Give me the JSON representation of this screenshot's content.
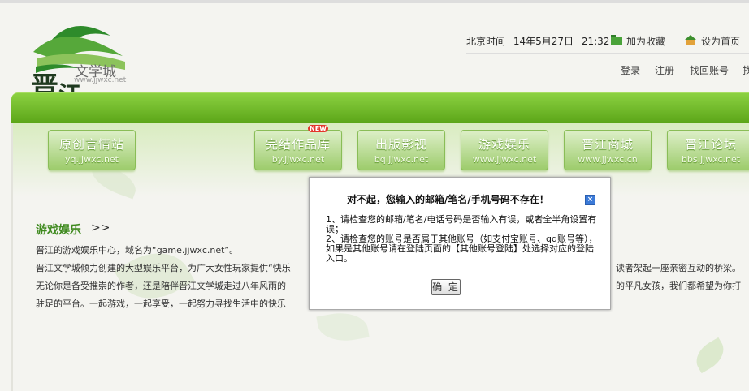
{
  "logo": {
    "text": "文学城",
    "url": "www.jjwxc.net"
  },
  "header": {
    "time_label": "北京时间",
    "date": "14年5月27日",
    "time": "21:32",
    "bookmark": "加为收藏",
    "homepage": "设为首页"
  },
  "nav": {
    "login": "登录",
    "register": "注册",
    "recover": "找回账号",
    "more": "找"
  },
  "sites": [
    {
      "title": "原创言情站",
      "url": "yq.jjwxc.net"
    },
    {
      "title": "完结作品库",
      "url": "by.jjwxc.net",
      "badge": "NEW"
    },
    {
      "title": "出版影视",
      "url": "bq.jjwxc.net"
    },
    {
      "title": "游戏娱乐",
      "url": "www.jjwxc.net"
    },
    {
      "title": "晋江商城",
      "url": "www.jjwxc.cn"
    },
    {
      "title": "晋江论坛",
      "url": "bbs.jjwxc.net"
    }
  ],
  "section": {
    "title": "游戏娱乐",
    "arrow": ">>",
    "lines": [
      "晋江的游戏娱乐中心，域名为“game.jjwxc.net”。",
      "晋江文学城倾力创建的大型娱乐平台，为广大女性玩家提供“快乐",
      "无论你是备受推崇的作者，还是陪伴晋江文学城走过八年风雨的",
      "驻足的平台。一起游戏，一起享受，一起努力寻找生活中的快乐"
    ],
    "line2_tail": "读者架起一座亲密互动的桥梁。",
    "line3_tail": "的平凡女孩，我们都希望为你打"
  },
  "dialog": {
    "title": "对不起，您输入的邮箱/笔名/手机号码不存在！",
    "close": "×",
    "items": [
      "1、请检查您的邮箱/笔名/电话号码是否输入有误，或者全半角设置有误；",
      "2、请检查您的账号是否属于其他账号（如支付宝账号、qq账号等），如果是其他账号请在登陆页面的【其他账号登陆】处选择对应的登陆入口。"
    ],
    "confirm": "确 定"
  },
  "colors": {
    "brand_green": "#5aa417",
    "link_green": "#3f8a1f",
    "close_blue": "#3b7ad8"
  }
}
